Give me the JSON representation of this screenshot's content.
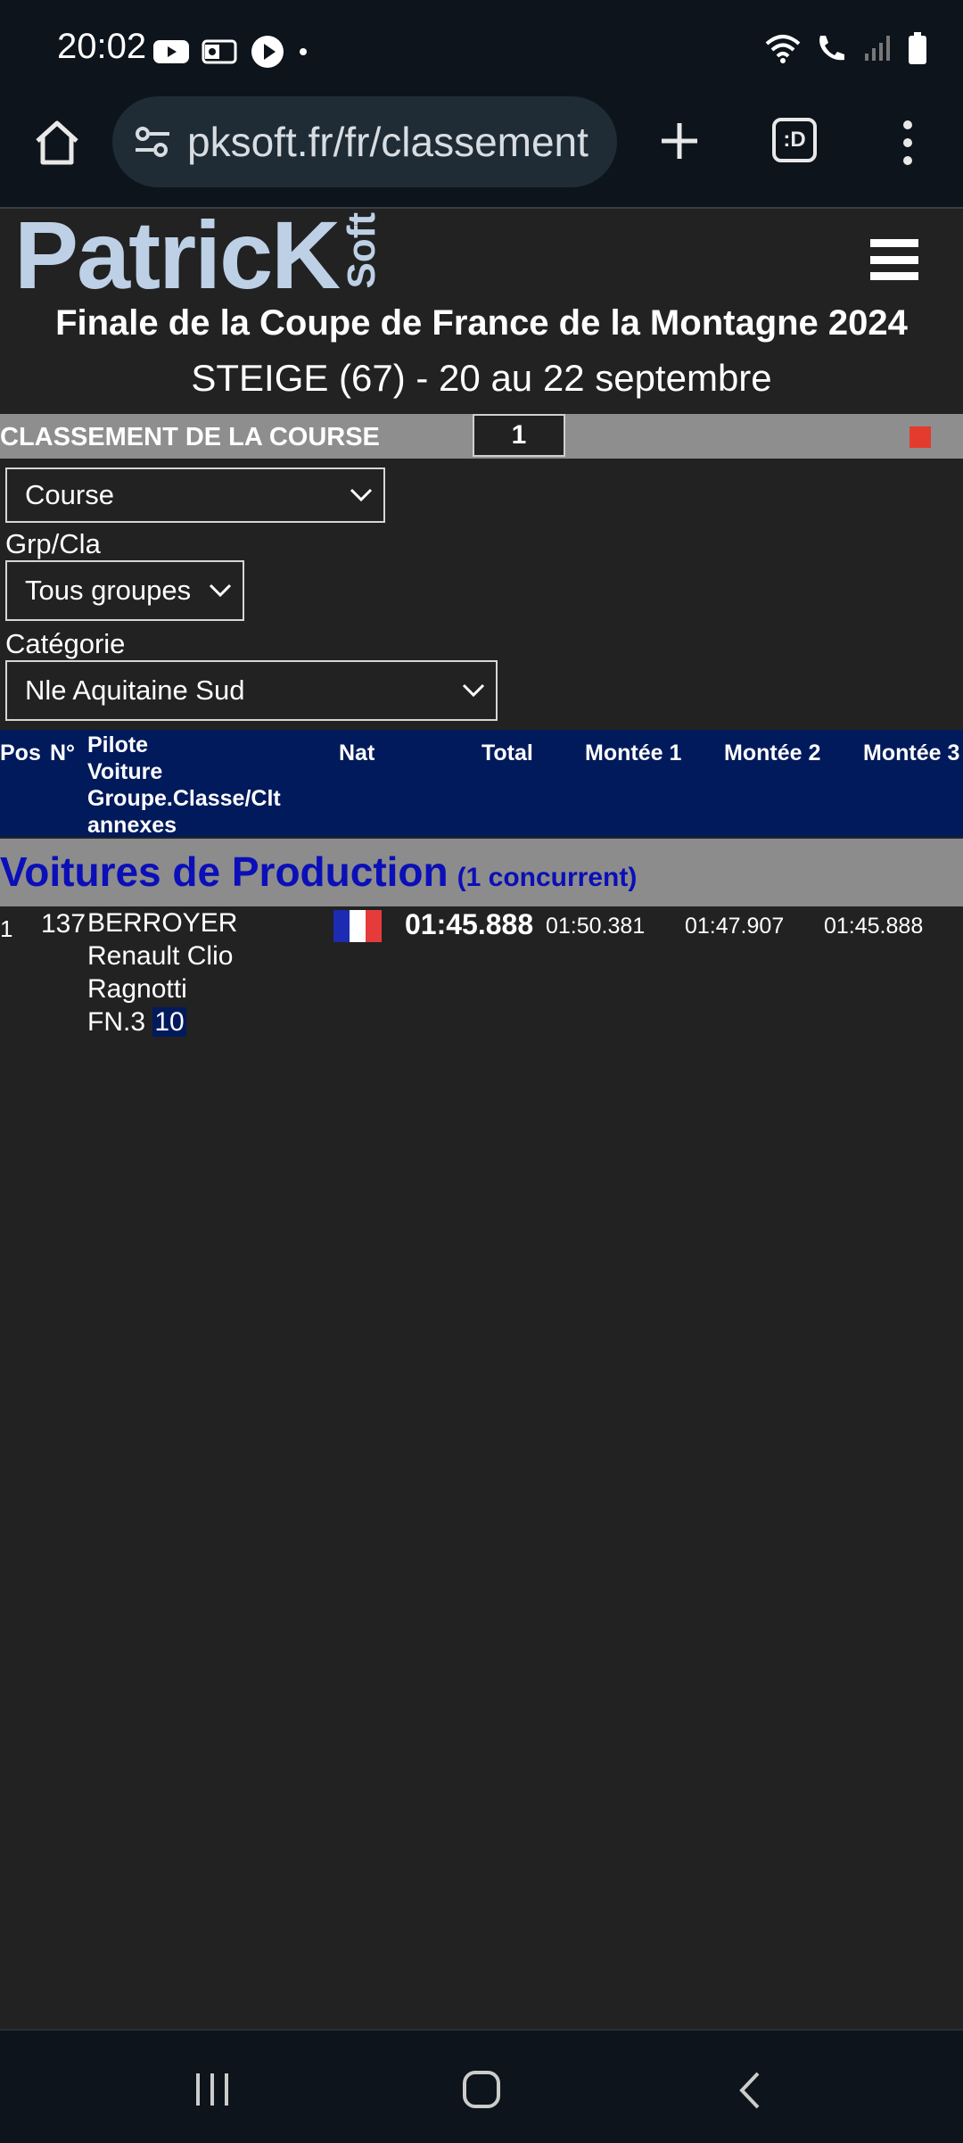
{
  "status_bar": {
    "time": "20:02"
  },
  "browser": {
    "url": "pksoft.fr/fr/classement",
    "tab_count": ":D"
  },
  "site": {
    "logo_main": "PatricK",
    "logo_sub": "Soft"
  },
  "event": {
    "title": "Finale de la Coupe de France de la Montagne 2024",
    "subtitle": "STEIGE (67) - 20 au 22 septembre"
  },
  "classement": {
    "label": "CLASSEMENT DE LA COURSE",
    "number": "1"
  },
  "filters": {
    "course_value": "Course",
    "grp_label": "Grp/Cla",
    "grp_value": "Tous groupes",
    "cat_label": "Catégorie",
    "cat_value": "Nle Aquitaine Sud"
  },
  "table": {
    "headers": {
      "pos": "Pos",
      "num": "N°",
      "pilote": "Pilote",
      "voiture": "Voiture",
      "groupe": "Groupe.Classe/Clt",
      "annexes": "annexes",
      "nat": "Nat",
      "total": "Total",
      "m1": "Montée 1",
      "m2": "Montée 2",
      "m3": "Montée 3"
    },
    "group": {
      "title": "Voitures de Production",
      "count": "(1 concurrent)"
    },
    "rows": [
      {
        "pos": "1",
        "num": "137",
        "pilote": "BERROYER",
        "voiture_1": "Renault Clio",
        "voiture_2": "Ragnotti",
        "groupe": "FN.3",
        "clt": "10",
        "total": "01:45.888",
        "m1": "01:50.381",
        "m2": "01:47.907",
        "m3": "01:45.888"
      }
    ]
  },
  "colors": {
    "header_blue": "#011a5c",
    "group_title_blue": "#0a0fb8",
    "bar_gray": "#8e8e8e",
    "page_bg": "#222222"
  }
}
